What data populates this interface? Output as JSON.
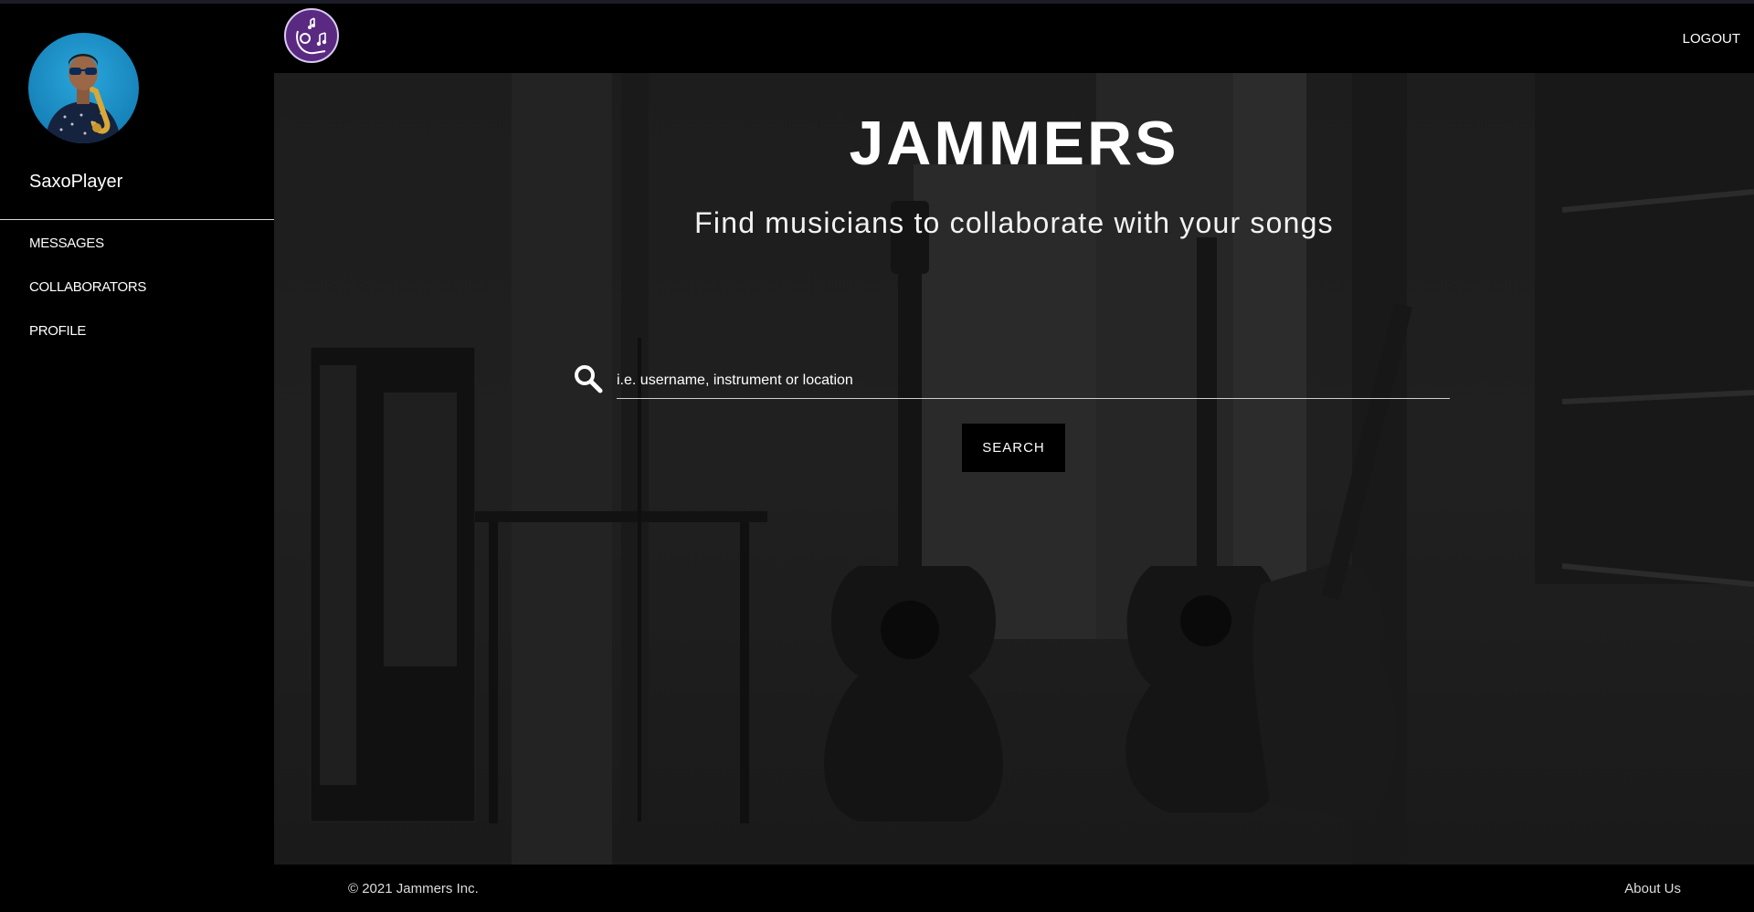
{
  "sidebar": {
    "username": "SaxoPlayer",
    "nav": [
      {
        "label": "MESSAGES"
      },
      {
        "label": "COLLABORATORS"
      },
      {
        "label": "PROFILE"
      }
    ]
  },
  "header": {
    "logout_label": "LOGOUT",
    "logo_icon": "music-notes-logo-icon"
  },
  "hero": {
    "title": "JAMMERS",
    "subtitle": "Find musicians to collaborate with your songs"
  },
  "search": {
    "placeholder": "i.e. username, instrument or location",
    "value": "",
    "button_label": "SEARCH",
    "icon": "search-icon"
  },
  "footer": {
    "copyright": "© 2021 Jammers Inc.",
    "about_label": "About Us"
  },
  "colors": {
    "background": "#000000",
    "logo_accent": "#5a2a82",
    "text": "#ffffff"
  }
}
